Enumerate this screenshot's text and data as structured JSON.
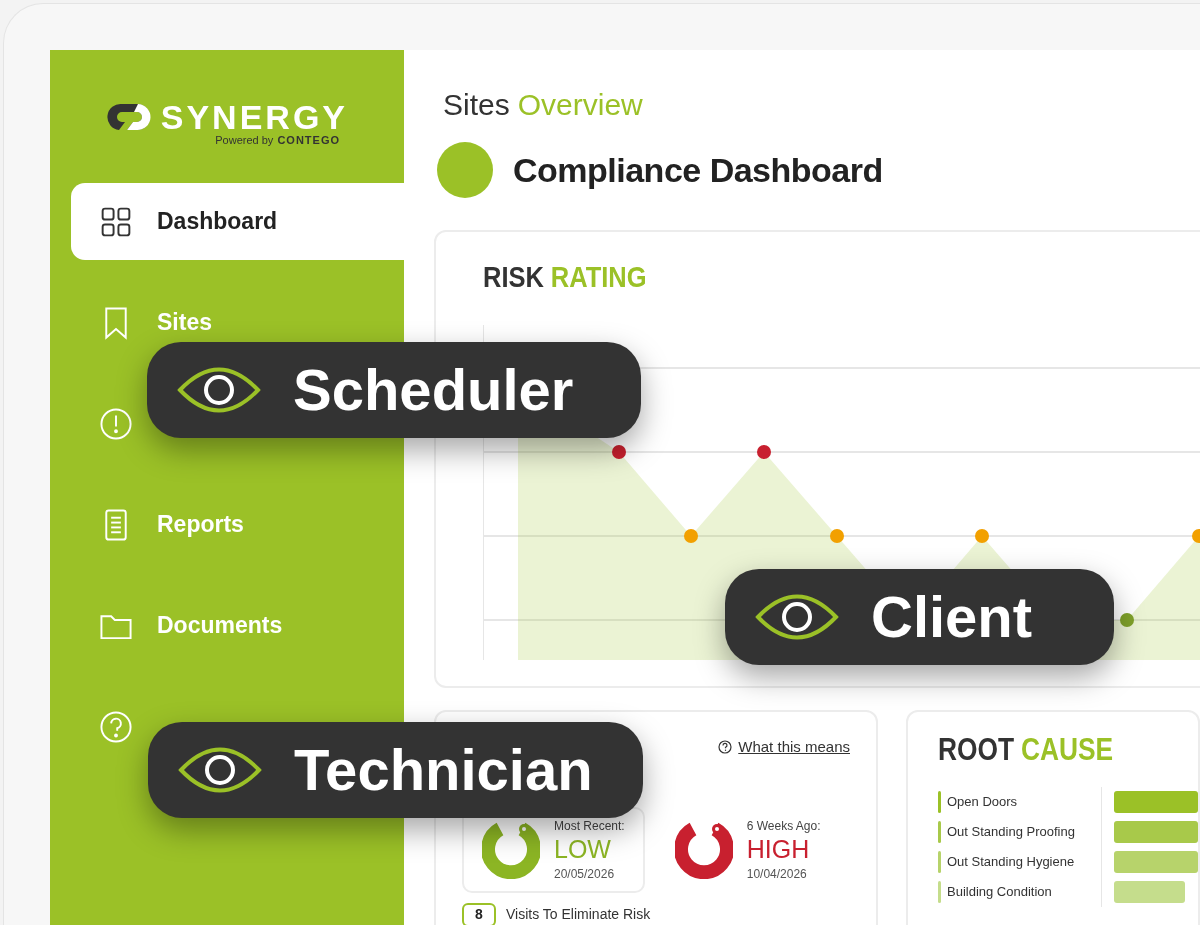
{
  "sidebar": {
    "logo": {
      "wordmark": "SYNERGY",
      "tagline": "Powered by",
      "partner": "CONTEGO"
    },
    "items": [
      {
        "label": "Dashboard",
        "selected": true
      },
      {
        "label": "Sites",
        "selected": false
      },
      {
        "selected": false
      },
      {
        "label": "Reports",
        "selected": false
      },
      {
        "label": "Documents",
        "selected": false
      },
      {
        "selected": false
      }
    ]
  },
  "header": {
    "breadcrumb": "Sites",
    "breadcrumb_accent": "Overview",
    "title": "Compliance Dashboard"
  },
  "risk_rating": {
    "title": "RISK",
    "title_accent": "RATING"
  },
  "risk_summary": {
    "help_link": "What this means",
    "cards": [
      {
        "caption": "Most Recent:",
        "rating": "LOW",
        "date": "20/05/2026",
        "kind": "low",
        "highlighted": true
      },
      {
        "caption": "6 Weeks Ago:",
        "rating": "HIGH",
        "date": "10/04/2026",
        "kind": "high",
        "highlighted": false
      }
    ],
    "visits_count": "8",
    "visits_label": "Visits To Eliminate Risk"
  },
  "root_cause": {
    "title": "ROOT",
    "title_accent": "CAUSE",
    "items": [
      {
        "label": "Open Doors",
        "color": "#9bc127",
        "level": 1
      },
      {
        "label": "Out Standing Proofing",
        "color": "#a8c94a",
        "level": 1
      },
      {
        "label": "Out Standing Hygiene",
        "color": "#b7d36b",
        "level": 1
      },
      {
        "label": "Building Condition",
        "color": "#c5dd8c",
        "level": 0.85
      }
    ]
  },
  "role_badges": [
    {
      "label": "Scheduler"
    },
    {
      "label": "Client"
    },
    {
      "label": "Technician"
    }
  ]
}
